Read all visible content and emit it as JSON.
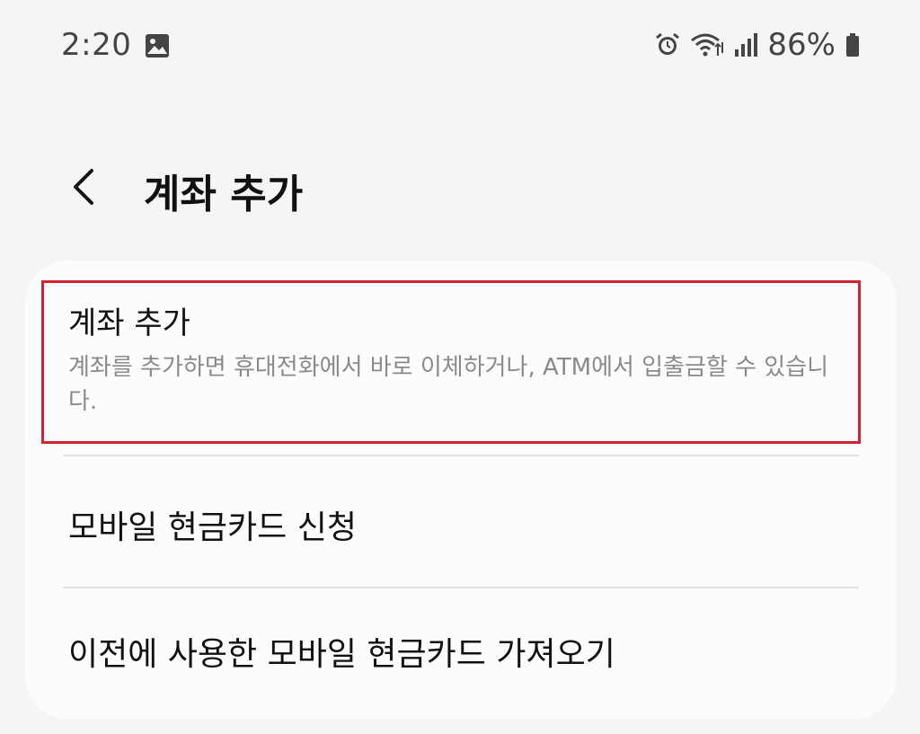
{
  "status_bar": {
    "time": "2:20",
    "battery_percent": "86%",
    "icons": [
      "gallery-icon",
      "alarm-icon",
      "wifi-icon",
      "signal-icon",
      "battery-icon"
    ]
  },
  "header": {
    "title": "계좌 추가",
    "back_icon": "chevron-left-icon"
  },
  "list": {
    "items": [
      {
        "title": "계좌 추가",
        "description": "계좌를 추가하면 휴대전화에서 바로 이체하거나, ATM에서 입출금할 수 있습니다."
      },
      {
        "title": "모바일 현금카드 신청"
      },
      {
        "title": "이전에 사용한 모바일 현금카드 가져오기"
      }
    ]
  },
  "colors": {
    "background": "#f5f5f7",
    "card": "#fcfcfe",
    "highlight": "#d0222f",
    "secondary_text": "#8a8a8a"
  }
}
